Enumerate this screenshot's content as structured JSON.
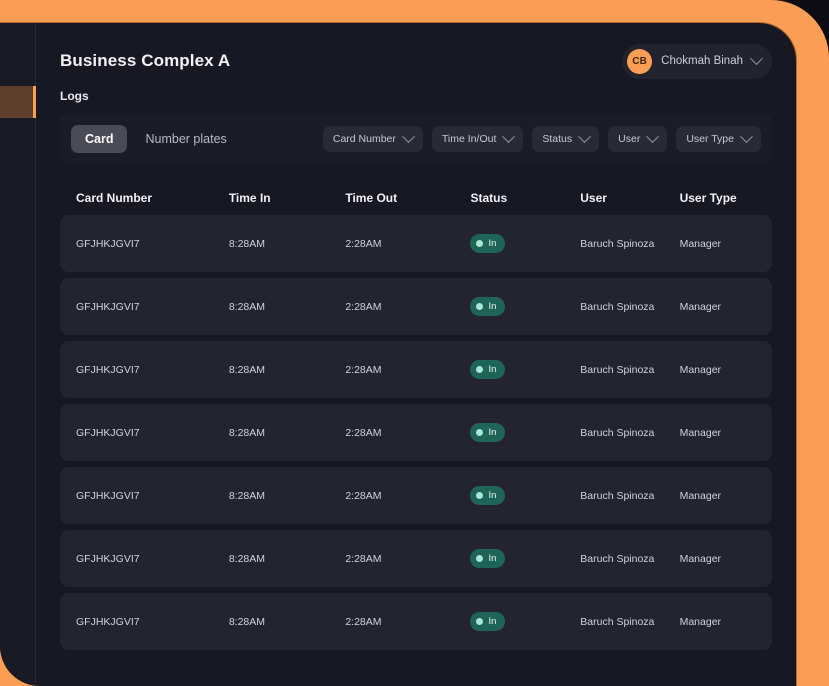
{
  "header": {
    "title": "Business Complex A",
    "user": {
      "initials": "CB",
      "name": "Chokmah Binah",
      "chevron_icon": "chevron-down-icon"
    }
  },
  "section": {
    "label": "Logs"
  },
  "toolbar": {
    "tabs": [
      {
        "label": "Card",
        "active": true
      },
      {
        "label": "Number plates",
        "active": false
      }
    ],
    "filters": [
      {
        "label": "Card Number",
        "icon": "chevron-down-icon"
      },
      {
        "label": "Time In/Out",
        "icon": "chevron-down-icon"
      },
      {
        "label": "Status",
        "icon": "chevron-down-icon"
      },
      {
        "label": "User",
        "icon": "chevron-down-icon"
      },
      {
        "label": "User Type",
        "icon": "chevron-down-icon"
      }
    ]
  },
  "table": {
    "columns": [
      "Card Number",
      "Time In",
      "Time Out",
      "Status",
      "User",
      "User Type"
    ],
    "rows": [
      {
        "card_number": "GFJHKJGVI7",
        "time_in": "8:28AM",
        "time_out": "2:28AM",
        "status": "In",
        "user": "Baruch Spinoza",
        "user_type": "Manager"
      },
      {
        "card_number": "GFJHKJGVI7",
        "time_in": "8:28AM",
        "time_out": "2:28AM",
        "status": "In",
        "user": "Baruch Spinoza",
        "user_type": "Manager"
      },
      {
        "card_number": "GFJHKJGVI7",
        "time_in": "8:28AM",
        "time_out": "2:28AM",
        "status": "In",
        "user": "Baruch Spinoza",
        "user_type": "Manager"
      },
      {
        "card_number": "GFJHKJGVI7",
        "time_in": "8:28AM",
        "time_out": "2:28AM",
        "status": "In",
        "user": "Baruch Spinoza",
        "user_type": "Manager"
      },
      {
        "card_number": "GFJHKJGVI7",
        "time_in": "8:28AM",
        "time_out": "2:28AM",
        "status": "In",
        "user": "Baruch Spinoza",
        "user_type": "Manager"
      },
      {
        "card_number": "GFJHKJGVI7",
        "time_in": "8:28AM",
        "time_out": "2:28AM",
        "status": "In",
        "user": "Baruch Spinoza",
        "user_type": "Manager"
      },
      {
        "card_number": "GFJHKJGVI7",
        "time_in": "8:28AM",
        "time_out": "2:28AM",
        "status": "In",
        "user": "Baruch Spinoza",
        "user_type": "Manager"
      }
    ]
  },
  "colors": {
    "accent_orange": "#fb9e55",
    "page_bg": "#181822",
    "row_bg": "#24242f",
    "toolbar_bg": "#1c1c26",
    "status_badge_bg": "#1e6558",
    "status_badge_dot": "#a9e6d6"
  }
}
